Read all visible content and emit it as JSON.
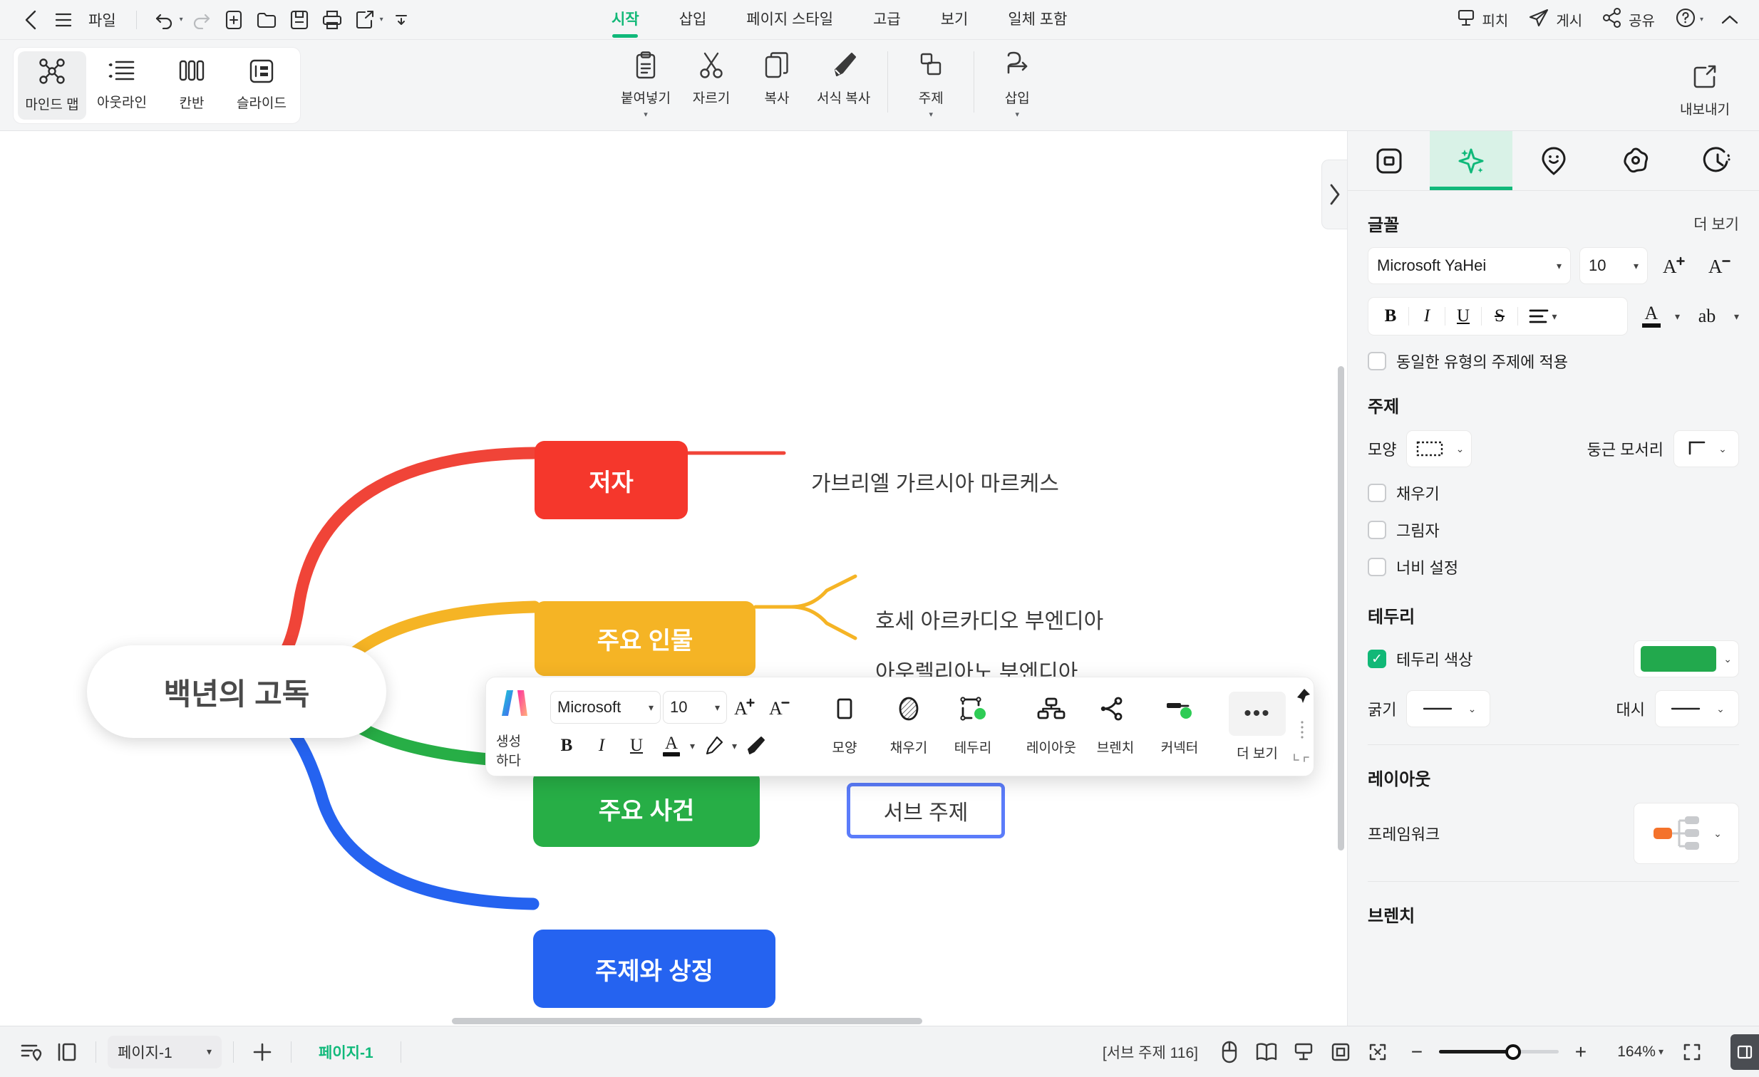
{
  "menubar": {
    "back_icon": "chevron-left-icon",
    "menu_icon": "hamburger-icon",
    "file_label": "파일",
    "quick_icons": [
      "undo-icon",
      "redo-icon",
      "new-icon",
      "open-icon",
      "save-icon",
      "print-icon",
      "share-export-icon",
      "more-icon"
    ],
    "tabs": [
      {
        "label": "시작",
        "active": true
      },
      {
        "label": "삽입",
        "active": false
      },
      {
        "label": "페이지 스타일",
        "active": false
      },
      {
        "label": "고급",
        "active": false
      },
      {
        "label": "보기",
        "active": false
      },
      {
        "label": "일체 포함",
        "active": false
      }
    ],
    "right_items": [
      {
        "label": "피치",
        "icon": "presentation-icon"
      },
      {
        "label": "게시",
        "icon": "paper-plane-icon"
      },
      {
        "label": "공유",
        "icon": "share-nodes-icon"
      }
    ],
    "help_label": "",
    "help_icon": "question-circle-icon",
    "collapse_icon": "chevron-up-icon"
  },
  "ribbon": {
    "views": [
      {
        "label": "마인드 맵",
        "icon": "mindmap-icon",
        "active": true
      },
      {
        "label": "아웃라인",
        "icon": "outline-list-icon",
        "active": false
      },
      {
        "label": "칸반",
        "icon": "kanban-icon",
        "active": false
      },
      {
        "label": "슬라이드",
        "icon": "slide-icon",
        "active": false
      }
    ],
    "actions": [
      {
        "label": "붙여넣기",
        "icon": "clipboard-paste-icon",
        "has_caret": true
      },
      {
        "label": "자르기",
        "icon": "scissors-icon",
        "has_caret": false
      },
      {
        "label": "복사",
        "icon": "copy-icon",
        "has_caret": false
      },
      {
        "label": "서식 복사",
        "icon": "format-painter-icon",
        "has_caret": false
      },
      {
        "label": "주제",
        "icon": "topic-shapes-icon",
        "has_caret": true
      },
      {
        "label": "삽입",
        "icon": "insert-arrow-icon",
        "has_caret": true
      }
    ],
    "export": {
      "label": "내보내기",
      "icon": "export-icon"
    }
  },
  "canvas": {
    "collapse_panel_icon": "chevron-right-icon",
    "root": {
      "text": "백년의 고독"
    },
    "branches": [
      {
        "text": "저자",
        "color": "#f5372c"
      },
      {
        "text": "주요 인물",
        "color": "#f5b425"
      },
      {
        "text": "주요 사건",
        "color": "#27ae46"
      },
      {
        "text": "주제와 상징",
        "color": "#2563f0"
      }
    ],
    "leaves": [
      {
        "text": "가브리엘 가르시아 마르케스",
        "color": "#f5372c"
      },
      {
        "text": "호세 아르카디오 부엔디아",
        "color": "#f5b425"
      },
      {
        "text": "아우렐리아노 부엔디아",
        "color": "#f5b425"
      }
    ],
    "selected_node": {
      "text": "서브 주제",
      "border_color": "#5b7cfa"
    }
  },
  "floatbar": {
    "ai_label": "생성하다",
    "ai_icon": "ai-sparkle-logo-icon",
    "font_name": "Microsoft",
    "font_size": "10",
    "grow_icon": "increase-font-icon",
    "shrink_icon": "decrease-font-icon",
    "bold": "B",
    "italic": "I",
    "underline": "U",
    "font_color_glyph": "A",
    "highlight_icon": "highlighter-icon",
    "format_painter_icon": "format-painter-icon",
    "shape_tools": [
      {
        "label": "모양",
        "icon": "shape-rect-icon"
      },
      {
        "label": "채우기",
        "icon": "fill-pattern-icon"
      },
      {
        "label": "테두리",
        "icon": "border-icon"
      }
    ],
    "structure_tools": [
      {
        "label": "레이아웃",
        "icon": "layout-tree-icon"
      },
      {
        "label": "브렌치",
        "icon": "branch-icon"
      },
      {
        "label": "커넥터",
        "icon": "connector-icon"
      }
    ],
    "more_label": "더 보기",
    "more_icon": "ellipsis-icon",
    "pin_icon": "pin-icon",
    "drag_icon": "drag-handle-icon",
    "resize_icon": "resize-corner-icon"
  },
  "panel": {
    "tabs": [
      {
        "icon": "page-frame-icon",
        "active": false
      },
      {
        "icon": "ai-sparkle-icon",
        "active": true
      },
      {
        "icon": "sticker-smiley-icon",
        "active": false
      },
      {
        "icon": "flower-gear-icon",
        "active": false
      },
      {
        "icon": "clock-history-icon",
        "active": false
      }
    ],
    "font": {
      "title": "글꼴",
      "more": "더 보기",
      "family": "Microsoft YaHei",
      "size": "10",
      "increase_icon": "increase-font-icon",
      "decrease_icon": "decrease-font-icon",
      "bold": "B",
      "italic": "I",
      "underline": "U",
      "strike": "S",
      "align_icon": "align-icon",
      "font_color_glyph": "A",
      "highlight_glyph": "ab",
      "apply_same_label": "동일한 유형의 주제에 적용",
      "apply_same_checked": false
    },
    "topic": {
      "title": "주제",
      "shape_label": "모양",
      "shape_value_icon": "dashed-rect-icon",
      "corner_label": "둥근 모서리",
      "corner_value_icon": "right-angle-corner-icon",
      "options": [
        {
          "label": "채우기",
          "checked": false
        },
        {
          "label": "그림자",
          "checked": false
        },
        {
          "label": "너비 설정",
          "checked": false
        }
      ]
    },
    "border": {
      "title": "테두리",
      "color_label": "테두리 색상",
      "color_checked": true,
      "color_value": "#22a94d",
      "weight_label": "굵기",
      "weight_icon": "solid-line-icon",
      "dash_label": "대시",
      "dash_icon": "solid-line-icon"
    },
    "layout": {
      "title": "레이아웃",
      "framework_label": "프레임워크",
      "framework_icon": "right-tree-layout-icon",
      "framework_accent": "#f4722b"
    },
    "branch": {
      "title": "브렌치"
    }
  },
  "statusbar": {
    "outline_icon": "outline-pin-icon",
    "pane_icon": "split-pane-icon",
    "page_select": "페이지-1",
    "add_icon": "plus-icon",
    "page_tab": "페이지-1",
    "selection_info": "[서브 주제 116]",
    "tool_icons": [
      "mouse-icon",
      "map-book-icon",
      "presentation-icon",
      "fit-selection-icon",
      "fit-screen-icon"
    ],
    "zoom_out_icon": "minus-icon",
    "zoom_in_icon": "plus-icon",
    "zoom_value": "164%",
    "zoom_caret_icon": "chevron-down-icon",
    "fullscreen_icon": "fullscreen-icon",
    "panel_toggle_icon": "panel-toggle-icon"
  }
}
